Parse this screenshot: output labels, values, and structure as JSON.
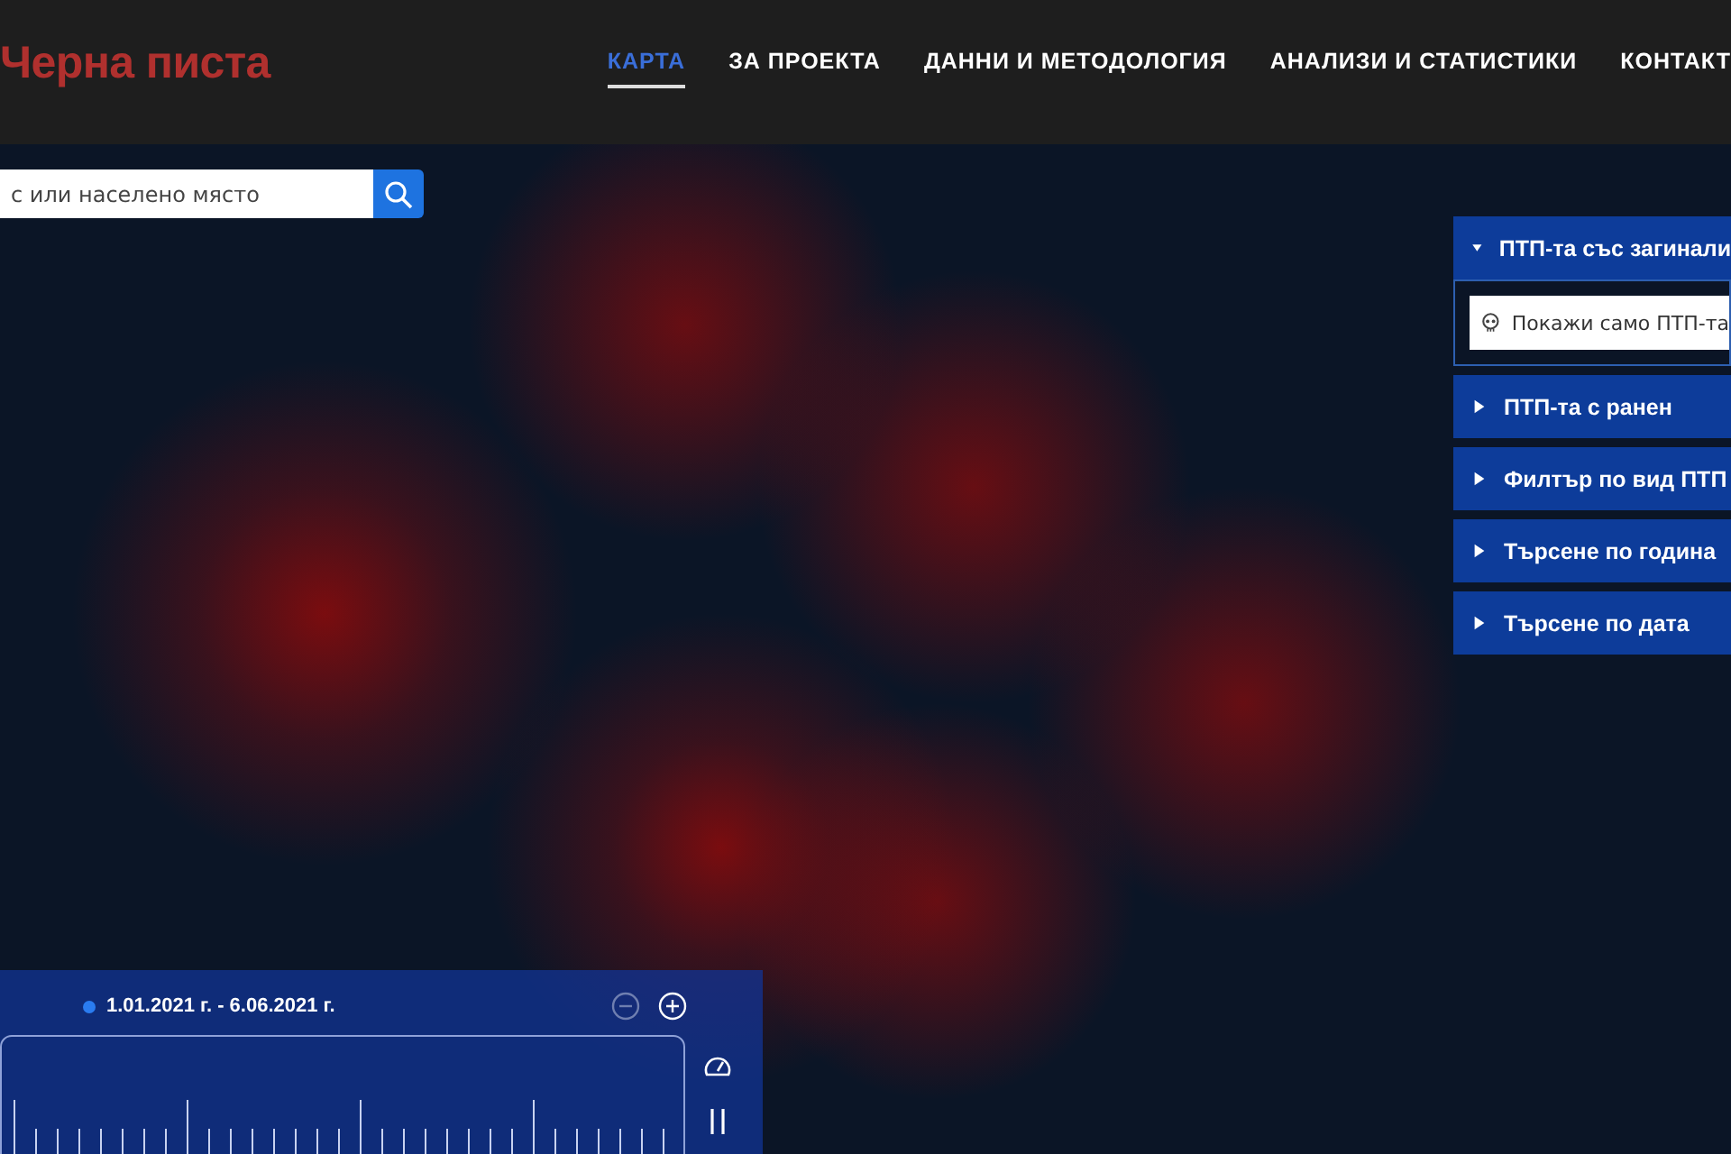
{
  "header": {
    "logo": "Черна писта",
    "nav": [
      {
        "label": "КАРТА",
        "selected": true
      },
      {
        "label": "ЗА ПРОЕКТА",
        "selected": false
      },
      {
        "label": "ДАННИ И МЕТОДОЛОГИЯ",
        "selected": false
      },
      {
        "label": "АНАЛИЗИ И СТАТИСТИКИ",
        "selected": false
      },
      {
        "label": "КОНТАКТ",
        "selected": false
      }
    ]
  },
  "search": {
    "placeholder": "с или населено място"
  },
  "filters": [
    {
      "label": "ПТП-та със загинали",
      "expanded": true,
      "option": {
        "label": "Покажи само ПТП-та",
        "checked": false
      }
    },
    {
      "label": "ПТП-та с ранен",
      "expanded": false
    },
    {
      "label": "Филтър по вид ПТП",
      "expanded": false
    },
    {
      "label": "Търсене по година",
      "expanded": false
    },
    {
      "label": "Търсене по дата",
      "expanded": false
    }
  ],
  "timeline": {
    "range": "1.01.2021 г. - 6.06.2021 г.",
    "playing": true
  }
}
